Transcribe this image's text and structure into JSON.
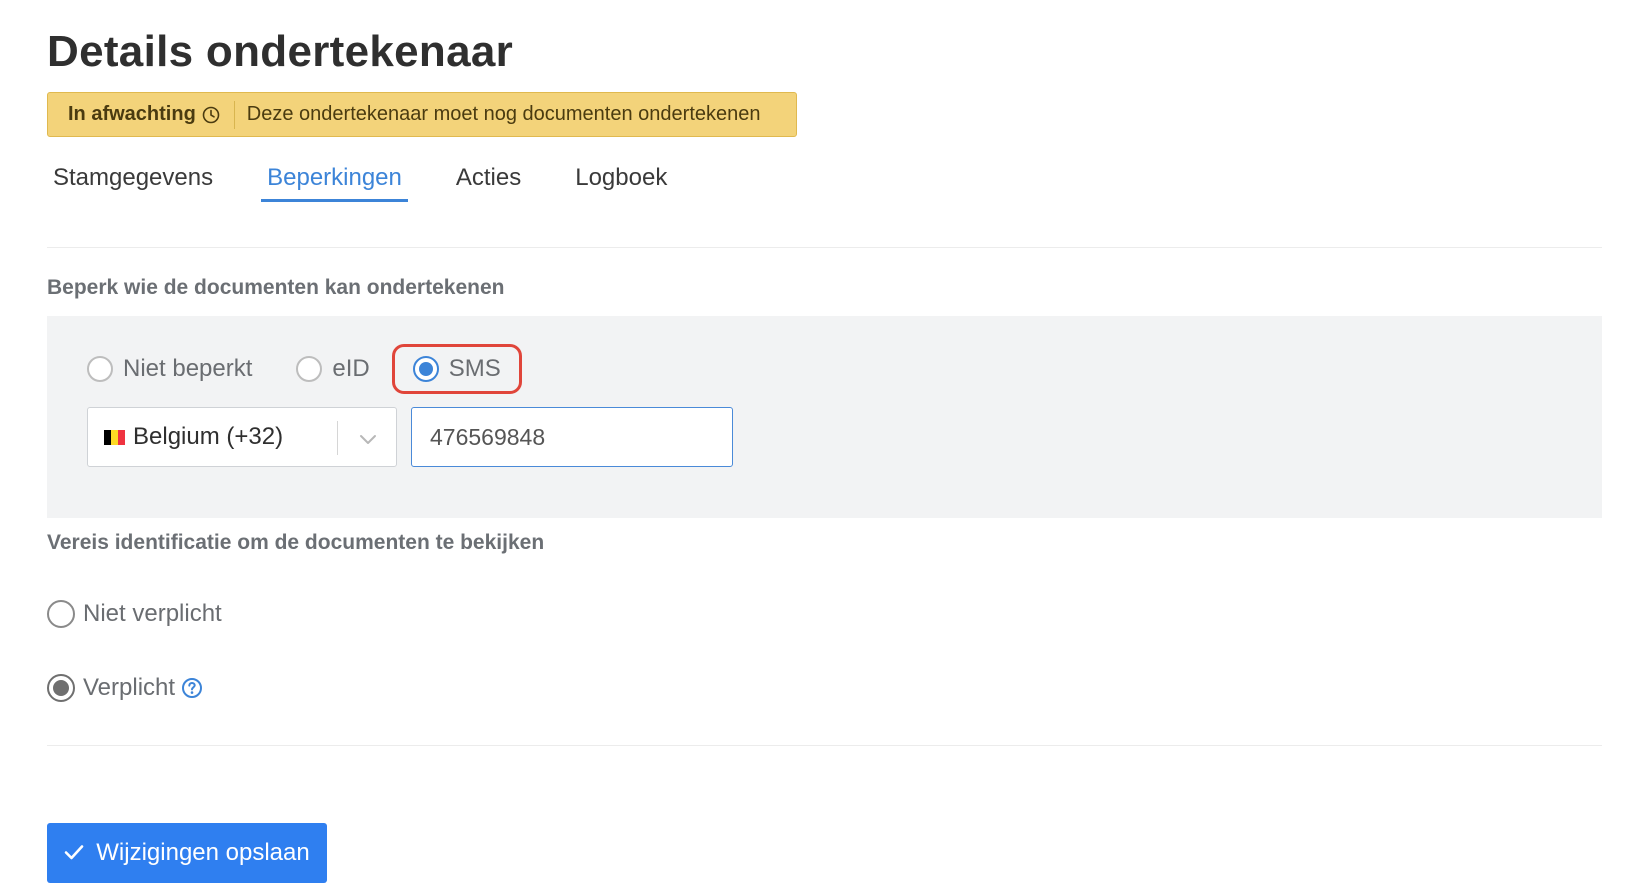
{
  "page": {
    "title": "Details ondertekenaar"
  },
  "status": {
    "label": "In afwachting",
    "message": "Deze ondertekenaar moet nog documenten ondertekenen",
    "color": "#f3d37a"
  },
  "tabs": [
    {
      "label": "Stamgegevens",
      "active": false
    },
    {
      "label": "Beperkingen",
      "active": true
    },
    {
      "label": "Acties",
      "active": false
    },
    {
      "label": "Logboek",
      "active": false
    }
  ],
  "restrict": {
    "heading": "Beperk wie de documenten kan ondertekenen",
    "options": [
      {
        "label": "Niet beperkt",
        "selected": false
      },
      {
        "label": "eID",
        "selected": false
      },
      {
        "label": "SMS",
        "selected": true
      }
    ],
    "country": {
      "label": "Belgium (+32)",
      "flag": "flag-be-icon"
    },
    "phone": {
      "value": "476569848"
    }
  },
  "identification": {
    "heading": "Vereis identificatie om de documenten te bekijken",
    "options": [
      {
        "label": "Niet verplicht",
        "selected": false
      },
      {
        "label": "Verplicht",
        "selected": true
      }
    ]
  },
  "actions": {
    "save_label": "Wijzigingen opslaan"
  },
  "colors": {
    "accent": "#3c84d8",
    "button": "#2f7ff0",
    "highlight": "#e0453a"
  }
}
